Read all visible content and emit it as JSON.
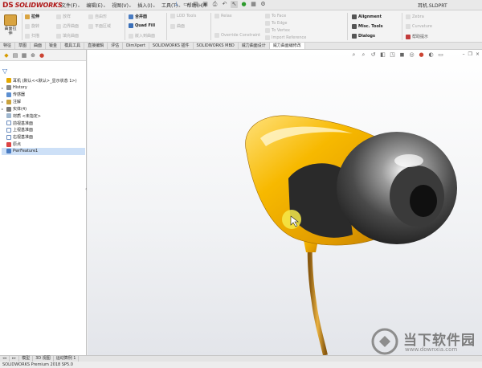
{
  "app": {
    "logo_prefix": "DS",
    "logo_text": "SOLIDWORKS",
    "document_title": "耳机.SLDPRT"
  },
  "menu": [
    "文件(F)",
    "编辑(E)",
    "视图(V)",
    "插入(I)",
    "工具(T)",
    "帮助(H)"
  ],
  "command_manager": {
    "big_button": [
      "曲面拉",
      "伸"
    ],
    "items": [
      {
        "label": "拉伸"
      },
      {
        "label": "旋转"
      },
      {
        "label": "扫描"
      },
      {
        "label": "放样"
      },
      {
        "label": "边界曲面"
      },
      {
        "label": "填充曲面"
      },
      {
        "label": "自由形"
      },
      {
        "label": "平面区域"
      },
      {
        "label": "合并面"
      },
      {
        "label": "Quad Fill"
      },
      {
        "label": "嵌入到曲面"
      },
      {
        "label": "LOD Tools"
      },
      {
        "label": "曲面"
      },
      {
        "label": "Relax"
      },
      {
        "label": "To Face"
      },
      {
        "label": "To Edge"
      },
      {
        "label": "To Vertex"
      },
      {
        "label": "Import Reference"
      },
      {
        "label": "Override Constraint"
      },
      {
        "label": "Alignment"
      },
      {
        "label": "Misc. Tools"
      },
      {
        "label": "Dialogs"
      },
      {
        "label": "Zebra"
      },
      {
        "label": "Curvature"
      },
      {
        "label": "帮助提示"
      }
    ]
  },
  "tabs": [
    {
      "label": "特征"
    },
    {
      "label": "草图"
    },
    {
      "label": "曲面"
    },
    {
      "label": "钣金"
    },
    {
      "label": "模具工具"
    },
    {
      "label": "直接编辑"
    },
    {
      "label": "评估"
    },
    {
      "label": "DimXpert"
    },
    {
      "label": "SOLIDWORKS 插件"
    },
    {
      "label": "SOLIDWORKS MBD"
    },
    {
      "label": "威力曲面设计"
    },
    {
      "label": "威力曲面编修改"
    }
  ],
  "feature_tree": [
    {
      "label": "耳机 (默认<<默认>_显示状态 1>)",
      "icon": "part-icon",
      "twisty": ""
    },
    {
      "label": "History",
      "icon": "history-icon",
      "twisty": "▸"
    },
    {
      "label": "传感器",
      "icon": "sensor-icon",
      "twisty": ""
    },
    {
      "label": "注解",
      "icon": "annotation-icon",
      "twisty": "▸"
    },
    {
      "label": "实体(4)",
      "icon": "solid-bodies-icon",
      "twisty": "▸"
    },
    {
      "label": "材质 <未指定>",
      "icon": "material-icon",
      "twisty": ""
    },
    {
      "label": "前视基准面",
      "icon": "plane-icon",
      "twisty": ""
    },
    {
      "label": "上视基准面",
      "icon": "plane-icon",
      "twisty": ""
    },
    {
      "label": "右视基准面",
      "icon": "plane-icon",
      "twisty": ""
    },
    {
      "label": "原点",
      "icon": "origin-icon",
      "twisty": ""
    },
    {
      "label": "PwrFeature1",
      "icon": "power-feature-icon",
      "twisty": ""
    }
  ],
  "bottom_tabs": [
    "模型",
    "3D 视图",
    "运动算例 1"
  ],
  "status_bar": "SOLIDWORKS Premium 2018 SP5.0",
  "watermark": {
    "title": "当下软件园",
    "url": "www.downxia.com"
  },
  "colors": {
    "accent_red": "#b01818",
    "earphone_body": "#f5b400",
    "earphone_tip": "#4a4a4a"
  }
}
